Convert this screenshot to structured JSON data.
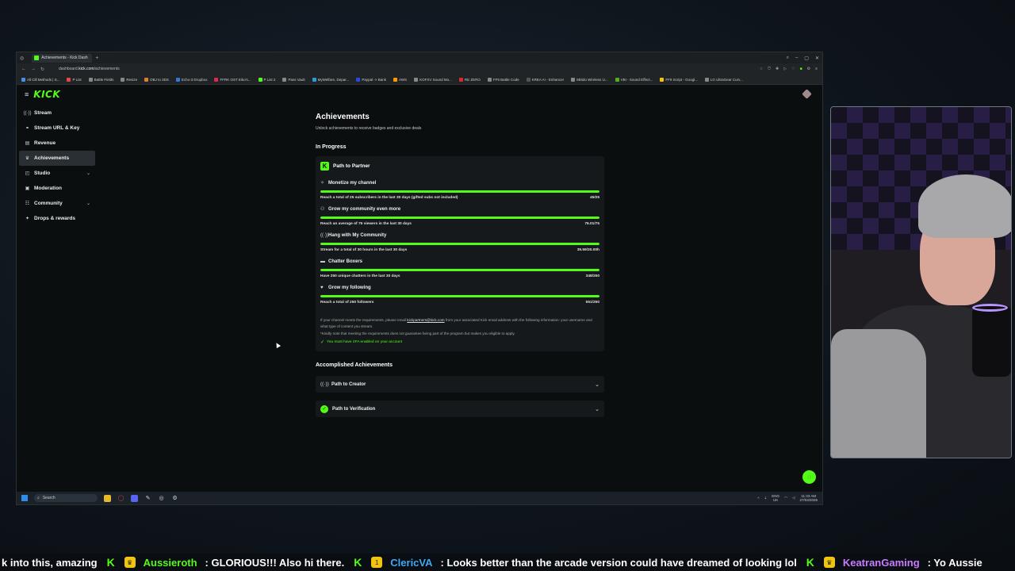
{
  "browser": {
    "tab_title": "Achievements - Kick Dash",
    "new_tab": "+",
    "url_prefix": "dashboard.",
    "url_domain": "kick.com",
    "url_path": "/achievements",
    "bookmarks": [
      {
        "label": "All Cill Methods | S...",
        "color": "#4a90e2"
      },
      {
        "label": "P List",
        "color": "#e24a4a"
      },
      {
        "label": "Battle Fields",
        "color": "#888888"
      },
      {
        "label": "Resize",
        "color": "#888888"
      },
      {
        "label": "OBJ to 3DS",
        "color": "#d9822b"
      },
      {
        "label": "Echo-3 Dropbox",
        "color": "#2b7bd9"
      },
      {
        "label": "FFRK OST Eiko's...",
        "color": "#d92b4a"
      },
      {
        "label": "P List 2",
        "color": "#53fc18"
      },
      {
        "label": "Pass Vault",
        "color": "#888888"
      },
      {
        "label": "MyWelfare, Depar...",
        "color": "#2b9bd9"
      },
      {
        "label": "Paypal -> Bank",
        "color": "#2b4ad9"
      },
      {
        "label": "AWS",
        "color": "#ff9900"
      },
      {
        "label": "KOFXV Sound Mo...",
        "color": "#888888"
      },
      {
        "label": "RE ZERO",
        "color": "#d92b2b"
      },
      {
        "label": "FF9 Battle Code",
        "color": "#888888"
      },
      {
        "label": "KREA AI - Enhancer",
        "color": "#555555"
      },
      {
        "label": "8Bitdo Wireless U...",
        "color": "#888888"
      },
      {
        "label": "VBI - Sound Effect...",
        "color": "#53b018"
      },
      {
        "label": "FF9 Script - Googl...",
        "color": "#f4c20d"
      },
      {
        "label": "LG UltraGear Curv...",
        "color": "#888888"
      }
    ]
  },
  "sidebar": {
    "items": [
      {
        "label": "Stream",
        "icon": "stream-icon",
        "glyph": "((·))",
        "has_chevron": false,
        "active": false
      },
      {
        "label": "Stream URL & Key",
        "icon": "link-icon",
        "glyph": "⚭",
        "has_chevron": false,
        "active": false
      },
      {
        "label": "Revenue",
        "icon": "revenue-icon",
        "glyph": "▤",
        "has_chevron": false,
        "active": false
      },
      {
        "label": "Achievements",
        "icon": "trophy-icon",
        "glyph": "♛",
        "has_chevron": false,
        "active": true
      },
      {
        "label": "Studio",
        "icon": "studio-icon",
        "glyph": "◰",
        "has_chevron": true,
        "active": false
      },
      {
        "label": "Moderation",
        "icon": "moderation-icon",
        "glyph": "▣",
        "has_chevron": false,
        "active": false
      },
      {
        "label": "Community",
        "icon": "community-icon",
        "glyph": "☷",
        "has_chevron": true,
        "active": false
      },
      {
        "label": "Drops & rewards",
        "icon": "gift-icon",
        "glyph": "✦",
        "has_chevron": false,
        "active": false
      }
    ]
  },
  "main": {
    "title": "Achievements",
    "subtitle": "Unlock achievements to receive badges and exclusive deals",
    "in_progress_heading": "In Progress",
    "partner_card": {
      "title": "Path to Partner",
      "goals": [
        {
          "name": "Monetize my channel",
          "icon": "sparkle-icon",
          "glyph": "✧",
          "desc": "Reach a total of 25 subscribers in the last 30 days (gifted subs not included)",
          "value": "45/25",
          "progress": 1.0
        },
        {
          "name": "Grow my community even more",
          "icon": "users-icon",
          "glyph": "⚇",
          "desc": "Reach an average of 75 viewers in the last 30 days",
          "value": "76.01/75",
          "progress": 1.0
        },
        {
          "name": "Hang with My Community",
          "icon": "broadcast-icon",
          "glyph": "((·))",
          "desc": "Stream for a total of 30 hours in the last 30 days",
          "value": "39.59/30.00h",
          "progress": 1.0
        },
        {
          "name": "Chatter Boxers",
          "icon": "chat-icon",
          "glyph": "▬",
          "desc": "Have 250 unique chatters in the last 30 days",
          "value": "348/250",
          "progress": 1.0
        },
        {
          "name": "Grow my following",
          "icon": "heart-icon",
          "glyph": "♥",
          "desc": "Reach a total of 250 followers",
          "value": "551/250",
          "progress": 1.0
        }
      ],
      "note_pre": "If your channel meets the requirements, please email ",
      "note_email": "kickpartners@kick.com",
      "note_post": " from your associated Kick email address with the following information: your username and what type of content you stream.",
      "note2": "*Kindly note that meeting the requirements does not guarantee being part of the program but makes you eligible to apply.",
      "requirement": "You must have 2FA enabled on your account"
    },
    "accomplished_heading": "Accomplished Achievements",
    "accomplished": [
      {
        "label": "Path to Creator",
        "icon": "broadcast-icon",
        "glyph": "((·))",
        "green": false
      },
      {
        "label": "Path to Verification",
        "icon": "verified-icon",
        "glyph": "✓",
        "green": true
      }
    ]
  },
  "taskbar": {
    "search_placeholder": "Search",
    "lang_top": "ENG",
    "lang_bottom": "UK",
    "time": "11:33 AM",
    "date": "27/03/2026"
  },
  "ticker": [
    {
      "type": "msg",
      "text": "k into this, amazing"
    },
    {
      "type": "k"
    },
    {
      "type": "badge",
      "glyph": "♛"
    },
    {
      "type": "name",
      "text": "Aussieroth",
      "color": "#53fc18"
    },
    {
      "type": "msg",
      "text": ": GLORIOUS!!! Also hi there."
    },
    {
      "type": "k"
    },
    {
      "type": "badge",
      "glyph": "1"
    },
    {
      "type": "name",
      "text": "ClericVA",
      "color": "#3fa9f5"
    },
    {
      "type": "msg",
      "text": ": Looks better than the arcade version could have dreamed of looking lol"
    },
    {
      "type": "k"
    },
    {
      "type": "badge",
      "glyph": "♛"
    },
    {
      "type": "name",
      "text": "KeatranGaming",
      "color": "#c77dff"
    },
    {
      "type": "msg",
      "text": ": Yo Aussie"
    }
  ],
  "colors": {
    "accent": "#53fc18",
    "bg": "#0b0e0f",
    "card": "#16191b"
  }
}
